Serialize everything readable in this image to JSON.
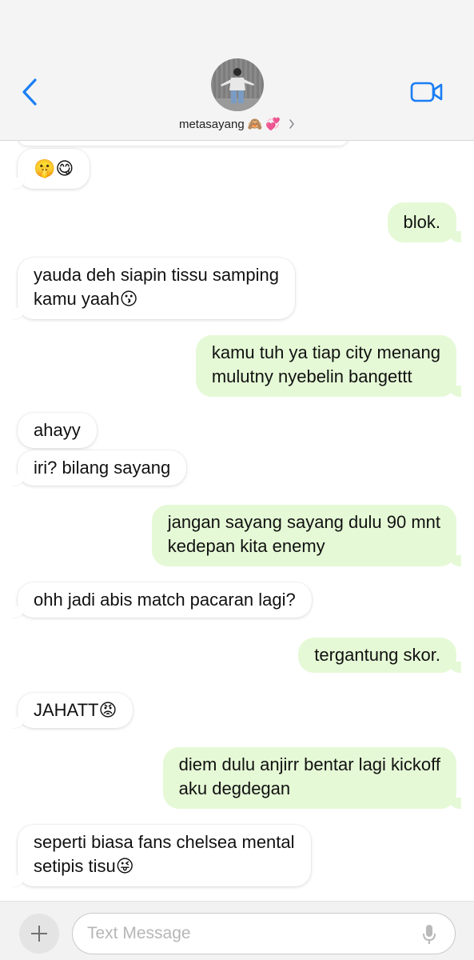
{
  "header": {
    "contact_name": "metasayang",
    "name_emojis": [
      "🙈",
      "💞"
    ]
  },
  "messages": [
    {
      "dir": "in",
      "text": "🤫😋"
    },
    {
      "dir": "out",
      "text": "blok."
    },
    {
      "dir": "in",
      "lines": [
        "yauda deh siapin tissu samping",
        "kamu yaah😗"
      ]
    },
    {
      "dir": "out",
      "lines": [
        "kamu tuh ya tiap city menang",
        "mulutny nyebelin bangettt"
      ]
    },
    {
      "dir": "in",
      "text": "ahayy"
    },
    {
      "dir": "in",
      "text": "iri? bilang sayang"
    },
    {
      "dir": "out",
      "lines": [
        "jangan sayang sayang dulu 90 mnt",
        "kedepan kita enemy"
      ]
    },
    {
      "dir": "in",
      "text": "ohh jadi abis match pacaran lagi?"
    },
    {
      "dir": "out",
      "text": "tergantung skor."
    },
    {
      "dir": "in",
      "text": "JAHATT😡"
    },
    {
      "dir": "out",
      "lines": [
        "diem dulu anjirr bentar lagi kickoff",
        "aku degdegan"
      ]
    },
    {
      "dir": "in",
      "lines": [
        "seperti biasa fans chelsea mental",
        "setipis tisu😜"
      ]
    }
  ],
  "composer": {
    "placeholder": "Text Message"
  },
  "colors": {
    "accent": "#1a7ef5",
    "outgoing_bubble": "#e5f9d6",
    "incoming_bubble": "#ffffff"
  }
}
